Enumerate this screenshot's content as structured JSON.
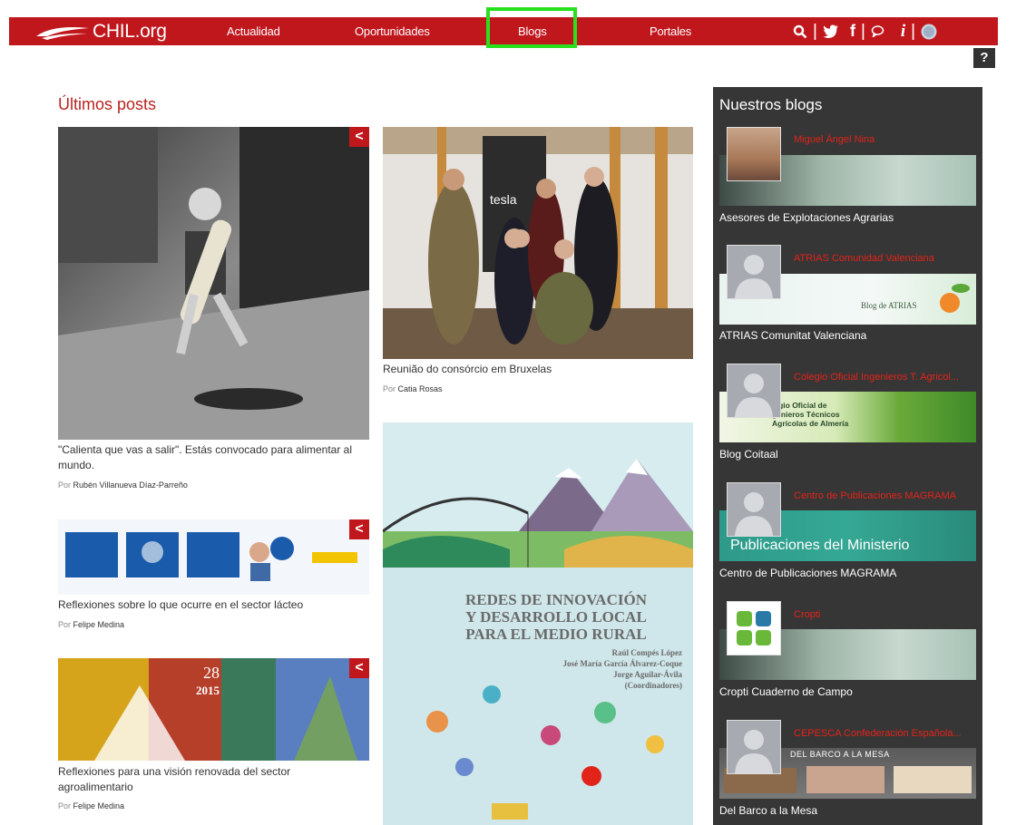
{
  "nav": {
    "logo_text": "CHIL.org",
    "links": [
      "Actualidad",
      "Oportunidades",
      "Blogs",
      "Portales"
    ],
    "active": "Blogs",
    "help": "?"
  },
  "latest": {
    "title": "Últimos posts",
    "posts": [
      {
        "title": "\"Calienta que vas a salir\". Estás convocado para alimentar al mundo.",
        "by": "Por",
        "author": "Rubén Villanueva Díaz-Parreño"
      },
      {
        "title": "Reunião do consórcio em Bruxelas",
        "by": "Por",
        "author": "Catia Rosas"
      },
      {
        "title": "Reflexiones sobre lo que ocurre en el sector lácteo",
        "by": "Por",
        "author": "Felipe Medina"
      },
      {
        "title": "Reflexiones para una visión renovada del sector agroalimentario",
        "by": "Por",
        "author": "Felipe Medina"
      }
    ],
    "poster_text": {
      "line1": "REDES DE INNOVACIÓN",
      "line2": "Y DESARROLLO LOCAL",
      "line3": "PARA EL MEDIO RURAL",
      "authors": [
        "Raúl Compés López",
        "José María García Álvarez-Coque",
        "Jorge Aguilar-Ávila",
        "(Coordinadores)"
      ]
    },
    "painting_text": {
      "a": "28",
      "b": "2015"
    },
    "tesla_text": "tesla"
  },
  "sidebar": {
    "title": "Nuestros blogs",
    "blogs": [
      {
        "author": "Miguel Ángel Nina",
        "name": "Asesores de Explotaciones Agrarias",
        "banner": ""
      },
      {
        "author": "ATRIAS Comunidad Valenciana",
        "name": "ATRIAS Comunitat Valenciana",
        "banner": "Blog de ATRIAS"
      },
      {
        "author": "Colegio Oficial Ingenieros T. Agricol...",
        "name": "Blog Coitaal",
        "banner": "legio Oficial de\ngenieros Técnicos\nAgrícolas de Almería"
      },
      {
        "author": "Centro de Publicaciones MAGRAMA",
        "name": "Centro de Publicaciones MAGRAMA",
        "banner": "Publicaciones del Ministerio"
      },
      {
        "author": "Cropti",
        "name": "Cropti Cuaderno de Campo",
        "banner": ""
      },
      {
        "author": "CEPESCA Confederación Española...",
        "name": "Del Barco a la Mesa",
        "banner": "DEL BARCO A LA MESA"
      }
    ]
  },
  "colors": {
    "brand": "#c0171d",
    "sidebar": "#363636",
    "highlight": "#28e01e"
  }
}
